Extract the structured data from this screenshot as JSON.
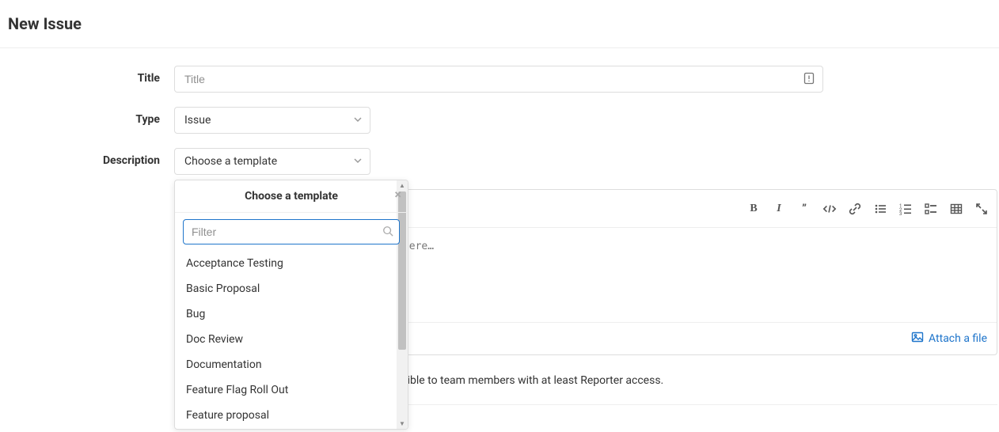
{
  "page": {
    "title": "New Issue"
  },
  "form": {
    "title": {
      "label": "Title",
      "placeholder": "Title",
      "value": ""
    },
    "type": {
      "label": "Type",
      "value": "Issue"
    },
    "description": {
      "label": "Description",
      "template_select_label": "Choose a template",
      "editor_placeholder": "Write a comment or drag your files here…",
      "attach_label": "Attach a file"
    },
    "confidential_note": "This issue is confidential and should only be visible to team members with at least Reporter access."
  },
  "template_dropdown": {
    "header": "Choose a template",
    "filter_placeholder": "Filter",
    "options": [
      "Acceptance Testing",
      "Basic Proposal",
      "Bug",
      "Doc Review",
      "Documentation",
      "Feature Flag Roll Out",
      "Feature proposal"
    ]
  },
  "toolbar_icons": [
    "bold-icon",
    "italic-icon",
    "quote-icon",
    "code-icon",
    "link-icon",
    "bullet-list-icon",
    "numbered-list-icon",
    "task-list-icon",
    "table-icon",
    "fullscreen-icon"
  ]
}
